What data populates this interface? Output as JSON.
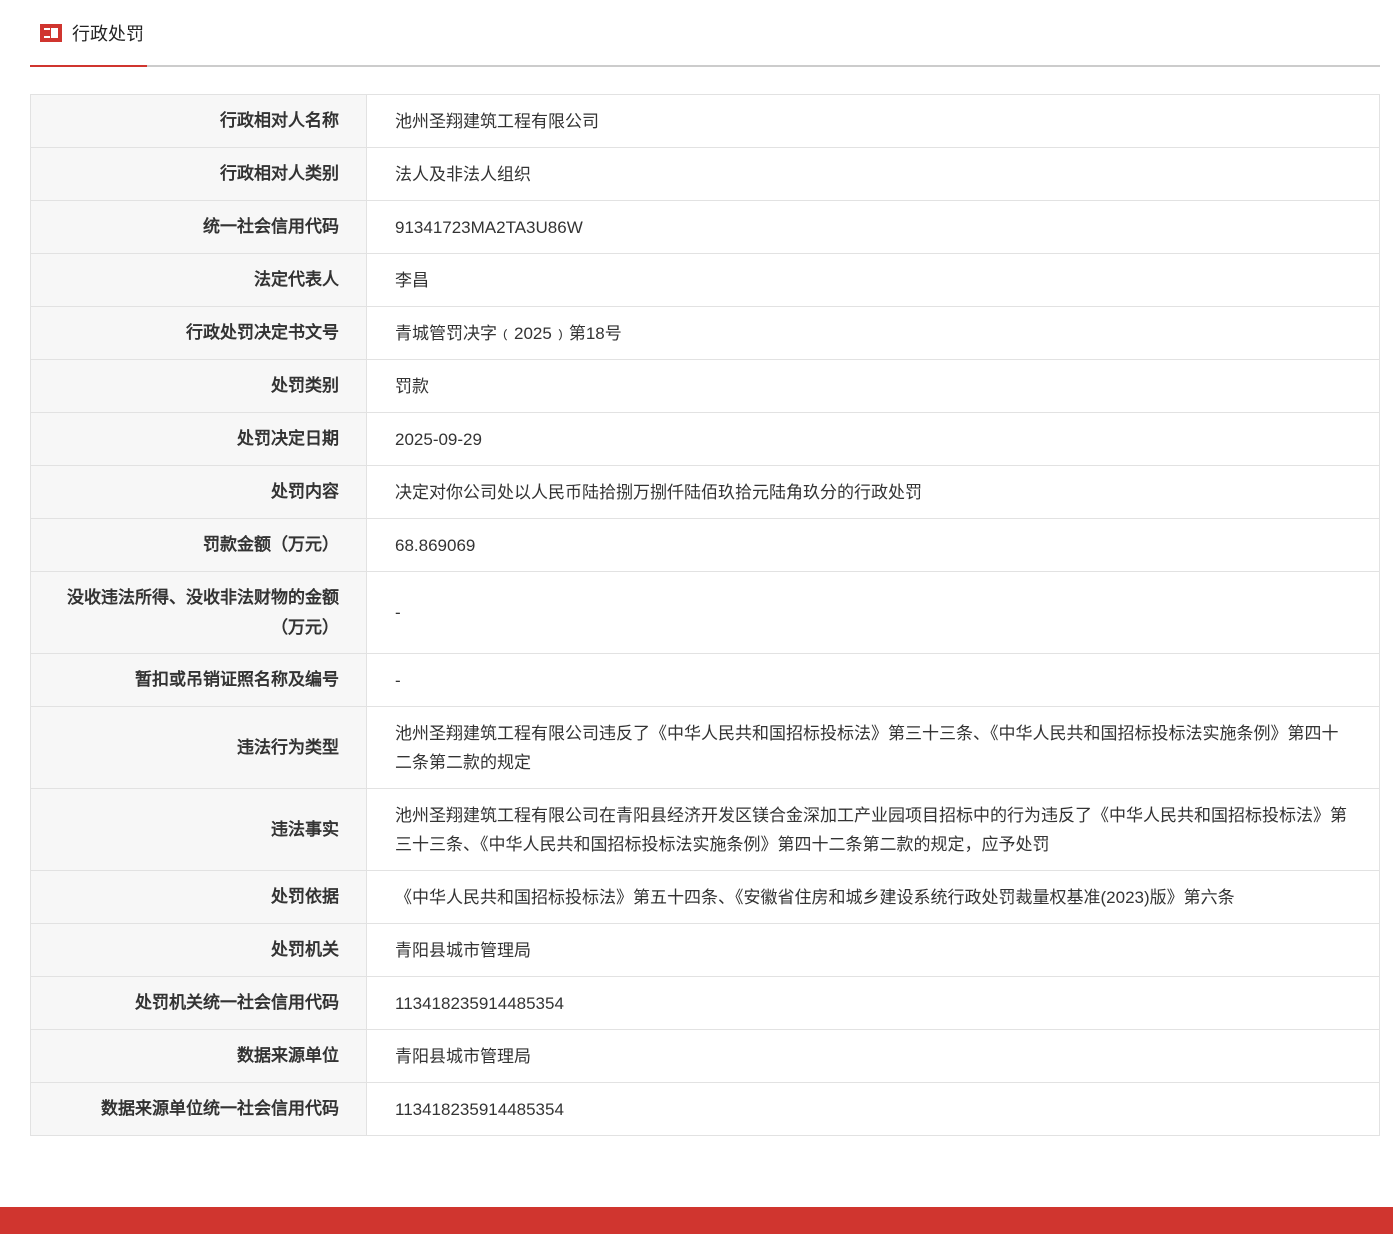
{
  "tab": {
    "label": "行政处罚",
    "icon": "news-icon"
  },
  "rows": [
    {
      "k": "行政相对人名称",
      "v": "池州圣翔建筑工程有限公司"
    },
    {
      "k": "行政相对人类别",
      "v": "法人及非法人组织"
    },
    {
      "k": "统一社会信用代码",
      "v": "91341723MA2TA3U86W"
    },
    {
      "k": "法定代表人",
      "v": "李昌"
    },
    {
      "k": "行政处罚决定书文号",
      "v": "青城管罚决字﹙2025﹚第18号"
    },
    {
      "k": "处罚类别",
      "v": "罚款"
    },
    {
      "k": "处罚决定日期",
      "v": "2025-09-29"
    },
    {
      "k": "处罚内容",
      "v": "决定对你公司处以人民币陆拾捌万捌仟陆佰玖拾元陆角玖分的行政处罚"
    },
    {
      "k": "罚款金额（万元）",
      "v": "68.869069"
    },
    {
      "k": "没收违法所得、没收非法财物的金额（万元）",
      "v": "-"
    },
    {
      "k": "暂扣或吊销证照名称及编号",
      "v": "-"
    },
    {
      "k": "违法行为类型",
      "v": "池州圣翔建筑工程有限公司违反了《中华人民共和国招标投标法》第三十三条、《中华人民共和国招标投标法实施条例》第四十二条第二款的规定"
    },
    {
      "k": "违法事实",
      "v": "池州圣翔建筑工程有限公司在青阳县经济开发区镁合金深加工产业园项目招标中的行为违反了《中华人民共和国招标投标法》第三十三条、《中华人民共和国招标投标法实施条例》第四十二条第二款的规定，应予处罚"
    },
    {
      "k": "处罚依据",
      "v": "《中华人民共和国招标投标法》第五十四条、《安徽省住房和城乡建设系统行政处罚裁量权基准(2023)版》第六条"
    },
    {
      "k": "处罚机关",
      "v": "青阳县城市管理局"
    },
    {
      "k": "处罚机关统一社会信用代码",
      "v": "113418235914485354"
    },
    {
      "k": "数据来源单位",
      "v": "青阳县城市管理局"
    },
    {
      "k": "数据来源单位统一社会信用代码",
      "v": "113418235914485354"
    }
  ]
}
